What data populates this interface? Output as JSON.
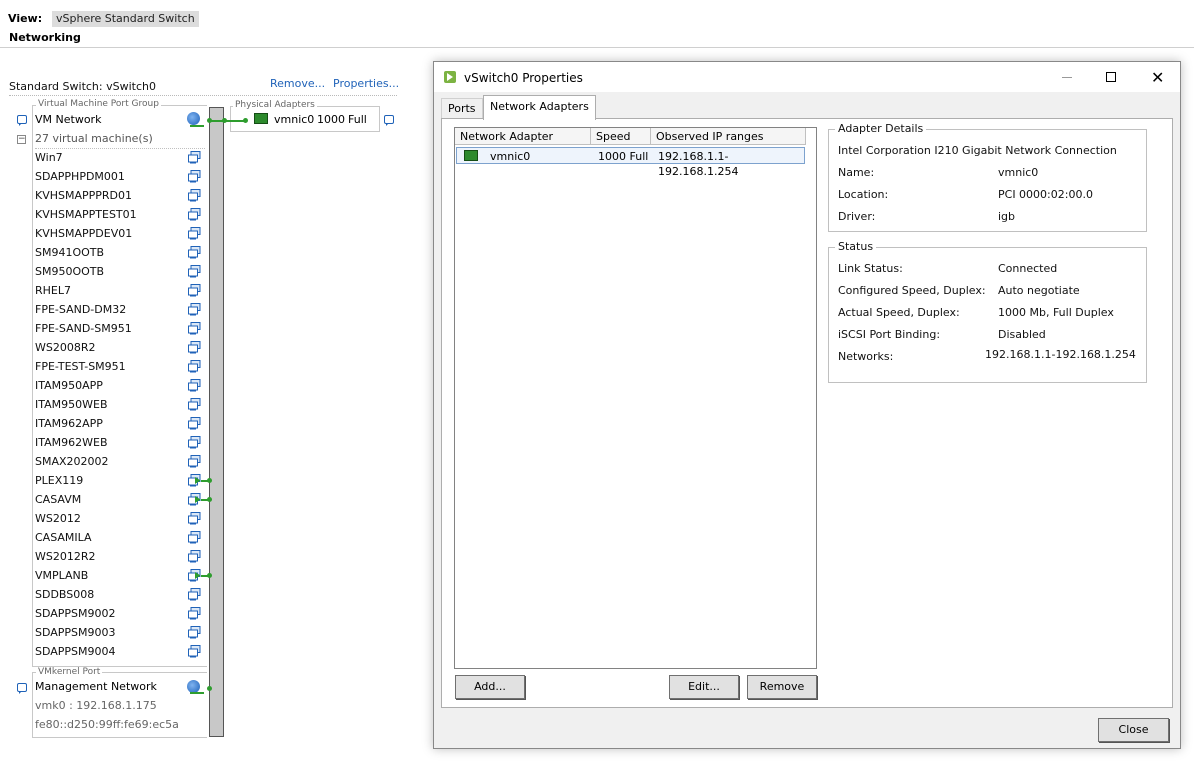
{
  "view": {
    "label": "View:",
    "selected": "vSphere Standard Switch"
  },
  "section_title": "Networking",
  "switch": {
    "title": "Standard Switch: vSwitch0",
    "remove_link": "Remove...",
    "properties_link": "Properties...",
    "port_group_label": "Virtual Machine Port Group",
    "port_group_name": "VM Network",
    "vm_count": "27 virtual machine(s)",
    "vms": [
      "Win7",
      "SDAPPHPDM001",
      "KVHSMAPPPRD01",
      "KVHSMAPPTEST01",
      "KVHSMAPPDEV01",
      "SM941OOTB",
      "SM950OOTB",
      "RHEL7",
      "FPE-SAND-DM32",
      "FPE-SAND-SM951",
      "WS2008R2",
      "FPE-TEST-SM951",
      "ITAM950APP",
      "ITAM950WEB",
      "ITAM962APP",
      "ITAM962WEB",
      "SMAX202002",
      "PLEX119",
      "CASAVM",
      "WS2012",
      "CASAMILA",
      "WS2012R2",
      "VMPLANB",
      "SDDBS008",
      "SDAPPSM9002",
      "SDAPPSM9003",
      "SDAPPSM9004"
    ],
    "physical_adapters_label": "Physical Adapters",
    "physical_adapter": {
      "name": "vmnic0",
      "speed": "1000",
      "duplex": "Full"
    },
    "vmkernel_label": "VMkernel Port",
    "vmkernel_name": "Management Network",
    "vmk_ipv4": "vmk0 : 192.168.1.175",
    "vmk_ipv6": "fe80::d250:99ff:fe69:ec5a"
  },
  "dialog": {
    "title": "vSwitch0 Properties",
    "tabs": [
      "Ports",
      "Network Adapters"
    ],
    "active_tab": "Network Adapters",
    "columns": [
      "Network Adapter",
      "Speed",
      "Observed IP ranges"
    ],
    "rows": [
      {
        "adapter": "vmnic0",
        "speed": "1000 Full",
        "ip_ranges": "192.168.1.1-192.168.1.254"
      }
    ],
    "buttons": {
      "add": "Add...",
      "edit": "Edit...",
      "remove": "Remove",
      "close": "Close"
    },
    "adapter_details": {
      "legend": "Adapter Details",
      "description": "Intel Corporation I210 Gigabit Network Connection",
      "name_label": "Name:",
      "name_value": "vmnic0",
      "location_label": "Location:",
      "location_value": "PCI 0000:02:00.0",
      "driver_label": "Driver:",
      "driver_value": "igb"
    },
    "status": {
      "legend": "Status",
      "link_status_label": "Link Status:",
      "link_status_value": "Connected",
      "configured_label": "Configured Speed, Duplex:",
      "configured_value": "Auto negotiate",
      "actual_label": "Actual Speed, Duplex:",
      "actual_value": "1000 Mb, Full Duplex",
      "iscsi_label": "iSCSI Port Binding:",
      "iscsi_value": "Disabled",
      "networks_label": "Networks:",
      "networks_value": "192.168.1.1-192.168.1.254"
    }
  },
  "colors": {
    "link": "#1f62b8",
    "bar": "#c8c8c8",
    "connector_green": "#2e9d2e",
    "selection": "#eef4fc"
  }
}
